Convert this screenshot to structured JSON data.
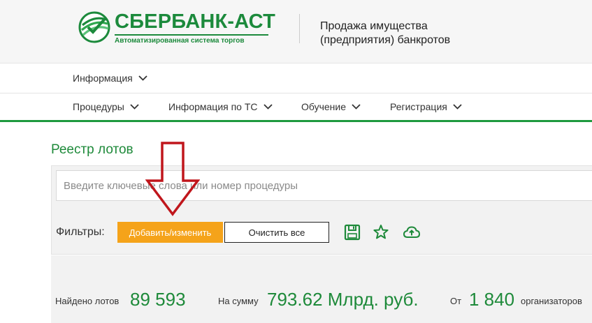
{
  "header": {
    "logo_name": "СБЕРБАНК-АСТ",
    "logo_tagline": "Автоматизированная система торгов",
    "title": "Продажа имущества (предприятия) банкротов"
  },
  "nav": {
    "row1": [
      {
        "label": "Информация"
      }
    ],
    "row2": [
      {
        "label": "Процедуры"
      },
      {
        "label": "Информация по ТС"
      },
      {
        "label": "Обучение"
      },
      {
        "label": "Регистрация"
      }
    ]
  },
  "main": {
    "title": "Реестр лотов",
    "search": {
      "placeholder": "Введите ключевые слова или номер процедуры",
      "value": ""
    },
    "filters": {
      "label": "Фильтры:",
      "add_button": "Добавить/изменить",
      "clear_button": "Очистить все",
      "icons": [
        "save-icon",
        "star-icon",
        "cloud-upload-icon"
      ]
    },
    "stats": {
      "found_label": "Найдено лотов",
      "found_value": "89 593",
      "sum_label": "На сумму",
      "sum_value": "793.62 Млрд. руб.",
      "from_label": "От",
      "from_value": "1 840",
      "organizers_label": "организаторов"
    }
  },
  "colors": {
    "brand_green": "#1e8a3a",
    "accent_orange": "#f5a31a",
    "annotation_red": "#c0161c"
  }
}
